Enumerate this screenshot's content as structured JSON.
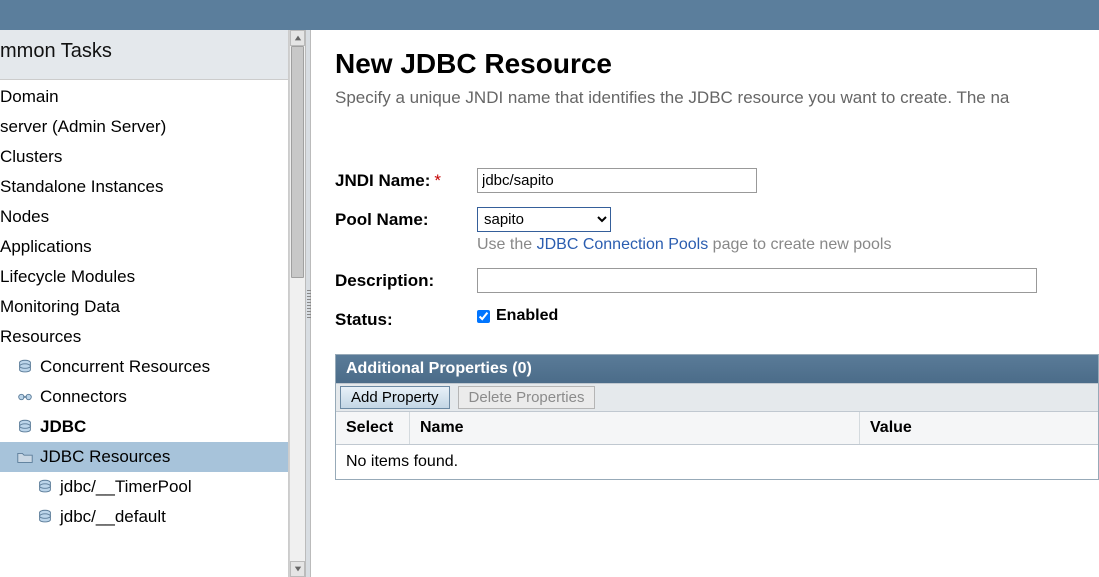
{
  "sidebar": {
    "header": "mmon Tasks",
    "items": [
      {
        "label": "Domain",
        "indent": 1,
        "icon": null
      },
      {
        "label": "server (Admin Server)",
        "indent": 1,
        "icon": null
      },
      {
        "label": "Clusters",
        "indent": 1,
        "icon": null
      },
      {
        "label": "Standalone Instances",
        "indent": 1,
        "icon": null
      },
      {
        "label": "Nodes",
        "indent": 1,
        "icon": null
      },
      {
        "label": "Applications",
        "indent": 1,
        "icon": null
      },
      {
        "label": "Lifecycle Modules",
        "indent": 1,
        "icon": null
      },
      {
        "label": "Monitoring Data",
        "indent": 1,
        "icon": null
      },
      {
        "label": "Resources",
        "indent": 1,
        "icon": null
      },
      {
        "label": "Concurrent Resources",
        "indent": 2,
        "icon": "db"
      },
      {
        "label": "Connectors",
        "indent": 2,
        "icon": "connector"
      },
      {
        "label": "JDBC",
        "indent": 2,
        "icon": "db",
        "bold": true
      },
      {
        "label": "JDBC Resources",
        "indent": 2,
        "icon": "folder",
        "selected": true
      },
      {
        "label": "jdbc/__TimerPool",
        "indent": 3,
        "icon": "db"
      },
      {
        "label": "jdbc/__default",
        "indent": 3,
        "icon": "db"
      }
    ]
  },
  "page": {
    "title": "New JDBC Resource",
    "description": "Specify a unique JNDI name that identifies the JDBC resource you want to create. The na"
  },
  "form": {
    "jndi_label": "JNDI Name:",
    "jndi_value": "jdbc/sapito",
    "pool_label": "Pool Name:",
    "pool_value": "sapito",
    "pool_hint_pre": "Use the ",
    "pool_hint_link": "JDBC Connection Pools",
    "pool_hint_post": " page to create new pools",
    "desc_label": "Description:",
    "desc_value": "",
    "status_label": "Status:",
    "status_checkbox_label": "Enabled",
    "status_checked": true
  },
  "panel": {
    "title": "Additional Properties (0)",
    "add_btn": "Add Property",
    "del_btn": "Delete Properties",
    "cols": {
      "select": "Select",
      "name": "Name",
      "value": "Value"
    },
    "empty": "No items found."
  }
}
